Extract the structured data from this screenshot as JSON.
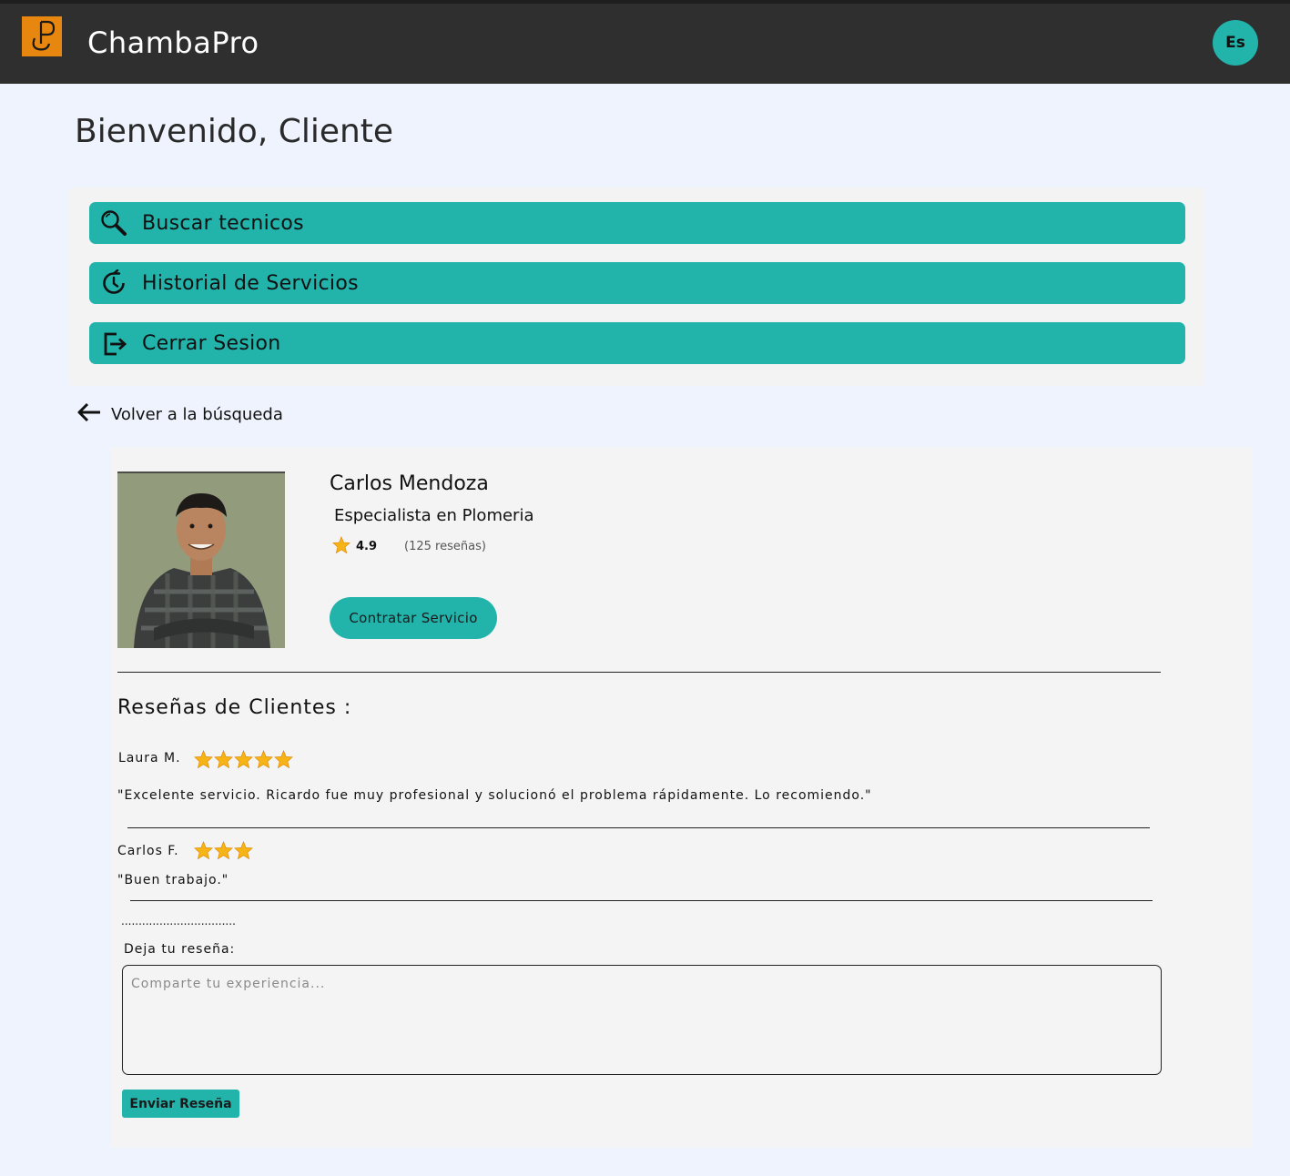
{
  "header": {
    "app_title": "ChambaPro",
    "language_badge": "Es",
    "logo_icon": "chambapro-logo-icon"
  },
  "welcome": "Bienvenido, Cliente",
  "menu": [
    {
      "label": "Buscar tecnicos",
      "icon": "search-icon"
    },
    {
      "label": "Historial de Servicios",
      "icon": "history-icon"
    },
    {
      "label": "Cerrar Sesion",
      "icon": "logout-icon"
    }
  ],
  "back_link": {
    "label": "Volver a la búsqueda",
    "icon": "arrow-left-icon"
  },
  "technician": {
    "name": "Carlos Mendoza",
    "specialty": "Especialista en Plomeria",
    "rating": "4.9",
    "review_count": "(125 reseñas)",
    "hire_button": "Contratar Servicio"
  },
  "reviews": {
    "title": "Reseñas de Clientes :",
    "items": [
      {
        "author": "Laura M.",
        "stars": 5,
        "text": "\"Excelente servicio. Ricardo fue muy profesional y solucionó el problema rápidamente. Lo recomiendo.\""
      },
      {
        "author": "Carlos F.",
        "stars": 3,
        "text": "\"Buen trabajo.\""
      }
    ],
    "separator_dots": ".................................",
    "leave_label": "Deja tu reseña:",
    "input_placeholder": "Comparte tu experiencia...",
    "submit_button": "Enviar Reseña"
  },
  "colors": {
    "accent": "#22b3ab",
    "header_bg": "#2f2f2f",
    "logo_bg": "#e8870f",
    "page_bg": "#eef3fd",
    "star": "#f6b417"
  }
}
